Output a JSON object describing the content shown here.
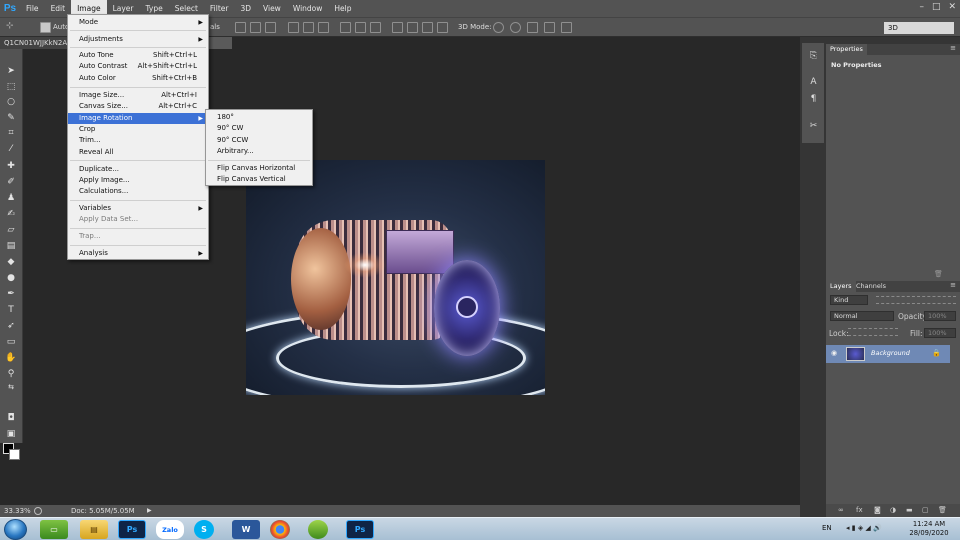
{
  "menubar": {
    "items": [
      "File",
      "Edit",
      "Image",
      "Layer",
      "Type",
      "Select",
      "Filter",
      "3D",
      "View",
      "Window",
      "Help"
    ],
    "active": "Image"
  },
  "app": {
    "logo": "Ps"
  },
  "options": {
    "auto_label": "Auto",
    "mode3d_label": "3D Mode:",
    "als_label": "als",
    "workspace": "3D"
  },
  "document": {
    "tab_title": "Q1CN01WJJKkN2A",
    "tab_suffix": "9 *"
  },
  "image_menu": {
    "items": [
      {
        "label": "Mode",
        "shortcut": "",
        "submenu": true,
        "disabled": false
      },
      {
        "label": "Adjustments",
        "shortcut": "",
        "submenu": true,
        "disabled": false
      },
      {
        "label": "Auto Tone",
        "shortcut": "Shift+Ctrl+L",
        "submenu": false,
        "disabled": false
      },
      {
        "label": "Auto Contrast",
        "shortcut": "Alt+Shift+Ctrl+L",
        "submenu": false,
        "disabled": false
      },
      {
        "label": "Auto Color",
        "shortcut": "Shift+Ctrl+B",
        "submenu": false,
        "disabled": false
      },
      {
        "label": "Image Size...",
        "shortcut": "Alt+Ctrl+I",
        "submenu": false,
        "disabled": false
      },
      {
        "label": "Canvas Size...",
        "shortcut": "Alt+Ctrl+C",
        "submenu": false,
        "disabled": false
      },
      {
        "label": "Image Rotation",
        "shortcut": "",
        "submenu": true,
        "disabled": false,
        "highlighted": true
      },
      {
        "label": "Crop",
        "shortcut": "",
        "submenu": false,
        "disabled": false
      },
      {
        "label": "Trim...",
        "shortcut": "",
        "submenu": false,
        "disabled": false
      },
      {
        "label": "Reveal All",
        "shortcut": "",
        "submenu": false,
        "disabled": false
      },
      {
        "label": "Duplicate...",
        "shortcut": "",
        "submenu": false,
        "disabled": false
      },
      {
        "label": "Apply Image...",
        "shortcut": "",
        "submenu": false,
        "disabled": false
      },
      {
        "label": "Calculations...",
        "shortcut": "",
        "submenu": false,
        "disabled": false
      },
      {
        "label": "Variables",
        "shortcut": "",
        "submenu": true,
        "disabled": false
      },
      {
        "label": "Apply Data Set...",
        "shortcut": "",
        "submenu": false,
        "disabled": true
      },
      {
        "label": "Trap...",
        "shortcut": "",
        "submenu": false,
        "disabled": true
      },
      {
        "label": "Analysis",
        "shortcut": "",
        "submenu": true,
        "disabled": false
      }
    ]
  },
  "rotation_menu": {
    "items": [
      {
        "label": "180°"
      },
      {
        "label": "90° CW"
      },
      {
        "label": "90° CCW"
      },
      {
        "label": "Arbitrary..."
      },
      {
        "label": "Flip Canvas Horizontal"
      },
      {
        "label": "Flip Canvas Vertical"
      }
    ]
  },
  "properties": {
    "tab": "Properties",
    "title": "No Properties"
  },
  "layers": {
    "tabs": [
      "Layers",
      "Channels"
    ],
    "kind": "Kind",
    "blend_mode": "Normal",
    "opacity_label": "Opacity:",
    "opacity_value": "100%",
    "lock_label": "Lock:",
    "fill_label": "Fill:",
    "fill_value": "100%",
    "layer_name": "Background"
  },
  "status": {
    "zoom": "33.33%",
    "doc_info": "Doc: 5.05M/5.05M"
  },
  "taskbar": {
    "apps": [
      "Ps",
      "Zalo",
      "S",
      "W",
      "Ps"
    ],
    "lang": "EN",
    "time": "11:24 AM",
    "date": "28/09/2020"
  }
}
